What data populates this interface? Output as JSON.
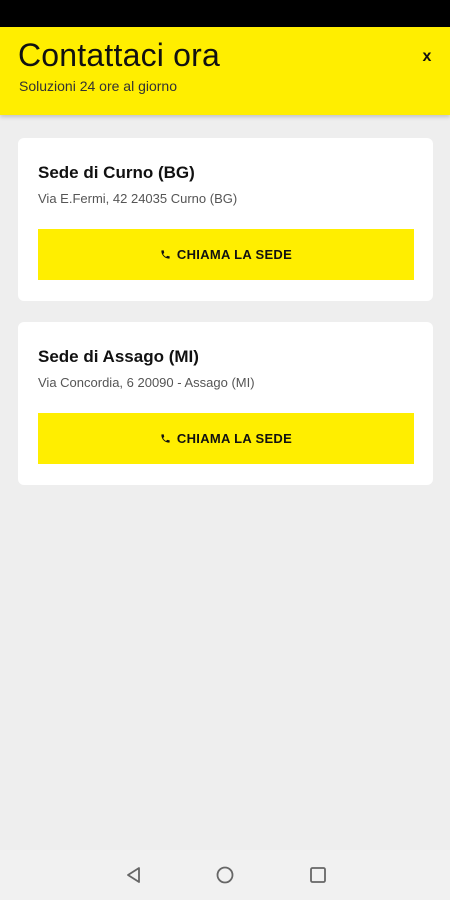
{
  "header": {
    "title": "Contattaci ora",
    "subtitle": "Soluzioni 24 ore al giorno",
    "close_label": "x"
  },
  "locations": [
    {
      "name": "Sede di Curno (BG)",
      "address": "Via E.Fermi, 42 24035 Curno (BG)",
      "call_label": "CHIAMA LA SEDE"
    },
    {
      "name": "Sede di Assago (MI)",
      "address": "Via Concordia, 6 20090 - Assago (MI)",
      "call_label": "CHIAMA LA SEDE"
    }
  ],
  "colors": {
    "accent": "#ffee00",
    "background": "#eeeeee",
    "card": "#ffffff"
  },
  "icons": [
    "phone-icon",
    "close-icon",
    "nav-back-icon",
    "nav-home-icon",
    "nav-recent-icon"
  ]
}
